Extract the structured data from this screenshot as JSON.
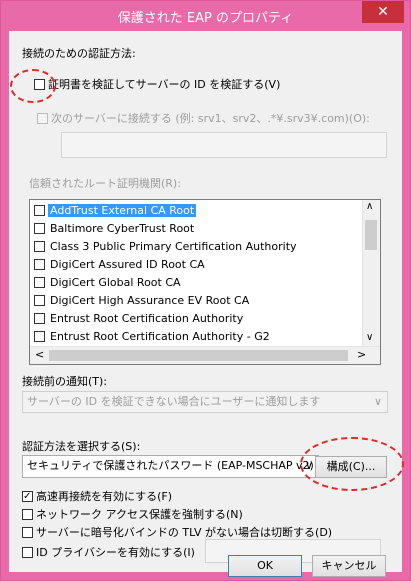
{
  "window": {
    "title": "保護された EAP のプロパティ",
    "close_glyph": "✕",
    "accent_color": "#e86aa8"
  },
  "auth_section": {
    "heading": "接続のための認証方法:",
    "verify_cert": {
      "label": "証明書を検証してサーバーの ID を検証する(V)",
      "checked": false
    },
    "connect_servers": {
      "label": "次のサーバーに接続する (例: srv1、srv2、.*¥.srv3¥.com)(O):",
      "value": ""
    },
    "trusted_root_label": "信頼されたルート証明機関(R):",
    "trusted_roots": [
      {
        "name": "AddTrust External CA Root",
        "selected": true
      },
      {
        "name": "Baltimore CyberTrust Root"
      },
      {
        "name": "Class 3 Public Primary Certification Authority"
      },
      {
        "name": "DigiCert Assured ID Root CA"
      },
      {
        "name": "DigiCert Global Root CA"
      },
      {
        "name": "DigiCert High Assurance EV Root CA"
      },
      {
        "name": "Entrust Root Certification Authority"
      },
      {
        "name": "Entrust Root Certification Authority - G2"
      }
    ],
    "notify_label": "接続前の通知(T):",
    "notify_value": "サーバーの ID を検証できない場合にユーザーに通知します"
  },
  "method_section": {
    "select_label": "認証方法を選択する(S):",
    "method_value": "セキュリティで保護されたパスワード (EAP-MSCHAP v2)",
    "configure_button": "構成(C)..."
  },
  "options": [
    {
      "label": "高速再接続を有効にする(F)",
      "checked": true
    },
    {
      "label": "ネットワーク アクセス保護を強制する(N)",
      "checked": false
    },
    {
      "label": "サーバーに暗号化バインドの TLV がない場合は切断する(D)",
      "checked": false
    },
    {
      "label": "ID プライバシーを有効にする(I)",
      "checked": false,
      "value": ""
    }
  ],
  "footer": {
    "ok": "OK",
    "cancel": "キャンセル"
  },
  "icons": {
    "scroll_up": "∧",
    "scroll_down": "∨",
    "scroll_left": "<",
    "scroll_right": ">",
    "dropdown": "∨"
  }
}
